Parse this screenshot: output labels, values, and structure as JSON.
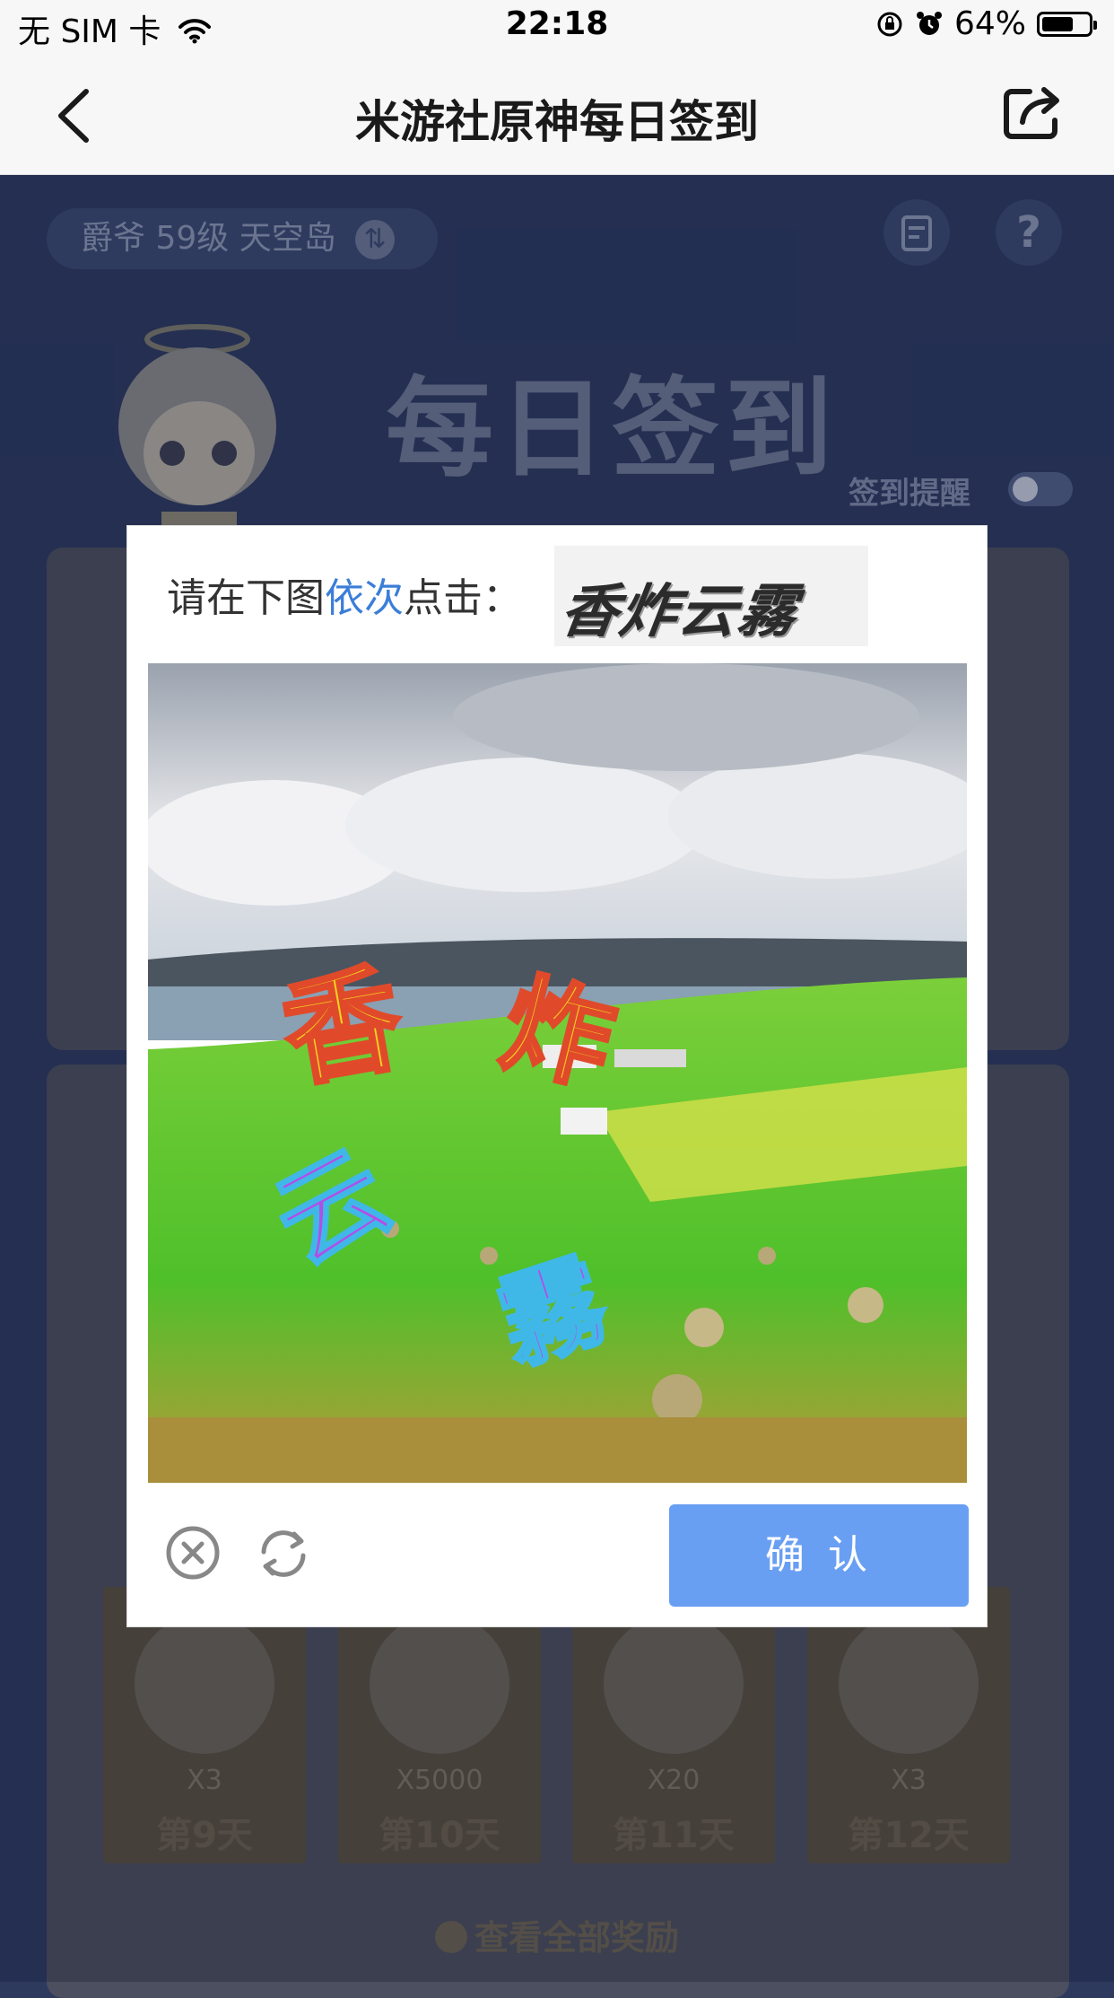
{
  "status_bar": {
    "carrier": "无 SIM 卡",
    "time": "22:18",
    "battery": "64%"
  },
  "nav": {
    "title": "米游社原神每日签到"
  },
  "page": {
    "user_info": "爵爷  59级  天空岛",
    "title": "每日签到",
    "remind_label": "签到提醒",
    "rewards": [
      {
        "qty": "X3",
        "day": "第9天"
      },
      {
        "qty": "X5000",
        "day": "第10天"
      },
      {
        "qty": "X20",
        "day": "第11天"
      },
      {
        "qty": "X3",
        "day": "第12天"
      }
    ],
    "view_all": "查看全部奖励"
  },
  "captcha": {
    "prompt_prefix": "请在下图",
    "prompt_highlight": "依次",
    "prompt_suffix": "点击：",
    "hint_chars": "香炸云霧",
    "image_chars": [
      "香",
      "炸",
      "云",
      "霧"
    ],
    "confirm_label": "确 认"
  },
  "colors": {
    "accent": "#699ff3",
    "highlight": "#3b7ed8",
    "page_bg": "#2c3a63"
  }
}
